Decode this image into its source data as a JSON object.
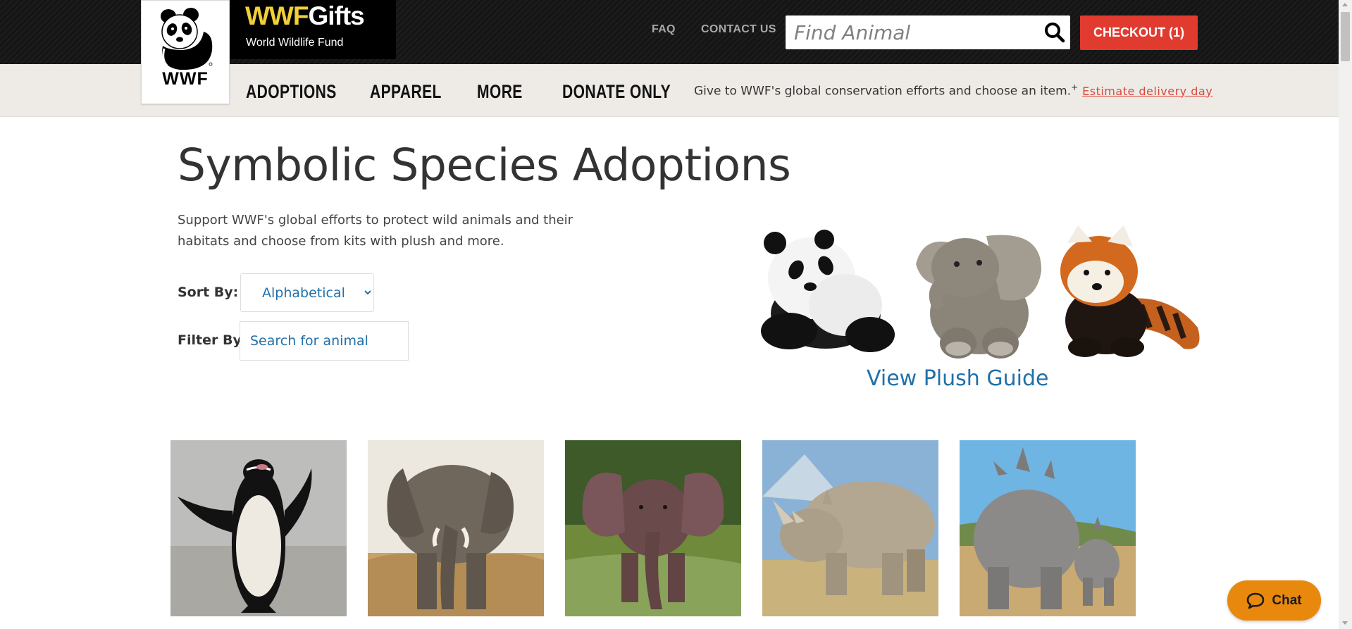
{
  "header": {
    "brand_logo": "WWF",
    "brand_name_a": "WWF",
    "brand_name_b": "Gifts",
    "brand_sub": "World Wildlife Fund",
    "links": {
      "faq": "FAQ",
      "contact": "CONTACT US"
    },
    "search_placeholder": "Find Animal",
    "search_icon": "magnifier",
    "checkout_label": "CHECKOUT (1)",
    "colors": {
      "brand_yellow": "#f2cf38",
      "checkout_red": "#e13b30"
    }
  },
  "nav": {
    "items": [
      {
        "label": "ADOPTIONS"
      },
      {
        "label": "APPAREL"
      },
      {
        "label": "MORE"
      },
      {
        "label": "DONATE ONLY"
      }
    ],
    "message": "Give to WWF's global conservation efforts and choose an item.",
    "message_mark": "+",
    "delivery_link": "Estimate delivery day"
  },
  "main": {
    "title": "Symbolic Species Adoptions",
    "description": "Support WWF's global efforts to protect wild animals and their habitats and choose from kits with plush and more.",
    "sort_label": "Sort By:",
    "sort_options": [
      "Alphabetical"
    ],
    "sort_selected": "Alphabetical",
    "filter_label": "Filter By:",
    "filter_placeholder": "Search for animal",
    "plush_images": [
      "panda-plush",
      "elephant-plush",
      "red-panda-plush"
    ],
    "plush_guide_label": "View Plush Guide",
    "animal_cards": [
      "penguin",
      "elephant",
      "baby-elephant",
      "rhino",
      "rhino-with-calf"
    ]
  },
  "chat": {
    "label": "Chat",
    "icon": "chat-bubble-icon",
    "color": "#e8890e"
  }
}
